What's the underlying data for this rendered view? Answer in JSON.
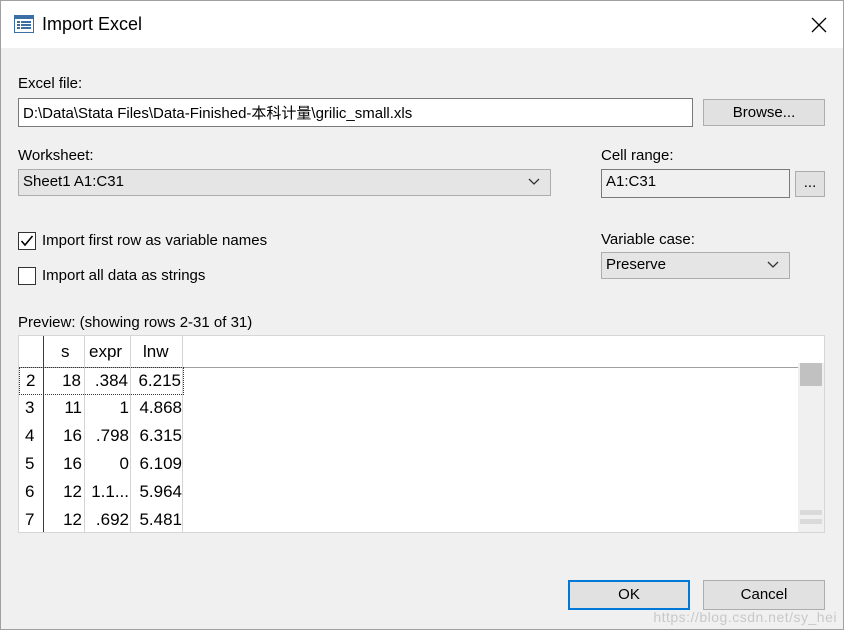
{
  "window": {
    "title": "Import Excel",
    "title_icon": "import-excel-icon",
    "close_icon": "close-icon"
  },
  "excel_file": {
    "label": "Excel file:",
    "value": "D:\\Data\\Stata Files\\Data-Finished-本科计量\\grilic_small.xls",
    "browse_label": "Browse..."
  },
  "worksheet": {
    "label": "Worksheet:",
    "selected": "Sheet1 A1:C31"
  },
  "cell_range": {
    "label": "Cell range:",
    "value": "A1:C31",
    "button_label": "..."
  },
  "options": {
    "first_row_names": {
      "label": "Import first row as variable names",
      "checked": true
    },
    "all_strings": {
      "label": "Import all data as strings",
      "checked": false
    }
  },
  "variable_case": {
    "label": "Variable case:",
    "selected": "Preserve"
  },
  "preview": {
    "label": "Preview: (showing rows 2-31 of 31)",
    "columns": [
      "s",
      "expr",
      "lnw"
    ],
    "rows": [
      {
        "n": "2",
        "cells": [
          "18",
          ".384",
          "6.215"
        ]
      },
      {
        "n": "3",
        "cells": [
          "11",
          "1",
          "4.868"
        ]
      },
      {
        "n": "4",
        "cells": [
          "16",
          ".798",
          "6.315"
        ]
      },
      {
        "n": "5",
        "cells": [
          "16",
          "0",
          "6.109"
        ]
      },
      {
        "n": "6",
        "cells": [
          "12",
          "1.1...",
          "5.964"
        ]
      },
      {
        "n": "7",
        "cells": [
          "12",
          ".692",
          "5.481"
        ]
      }
    ]
  },
  "buttons": {
    "ok": "OK",
    "cancel": "Cancel"
  },
  "watermark": "https://blog.csdn.net/sy_hei",
  "colors": {
    "accent": "#0078d7",
    "dialog_bg": "#f0f0f0"
  }
}
